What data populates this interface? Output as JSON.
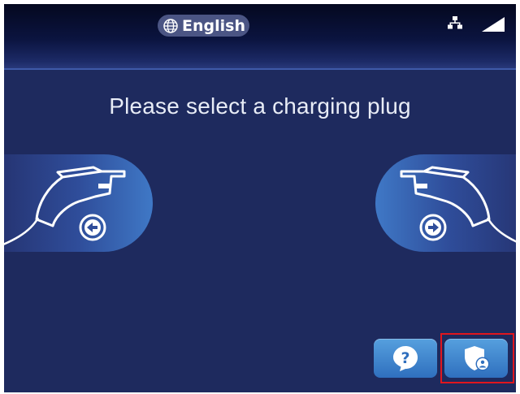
{
  "header": {
    "language_label": "English",
    "language_icon": "globe-icon",
    "network_icon": "network-icon",
    "signal_icon": "signal-strength-icon"
  },
  "main": {
    "title": "Please select a charging plug",
    "plugs": [
      {
        "side": "left",
        "icon": "charging-plug-icon",
        "arrow_icon": "arrow-left-circle-icon"
      },
      {
        "side": "right",
        "icon": "charging-plug-icon",
        "arrow_icon": "arrow-right-circle-icon"
      }
    ]
  },
  "footer": {
    "help_icon": "question-bubble-icon",
    "admin_icon": "shield-user-icon"
  },
  "colors": {
    "background": "#1e2a5e",
    "accent_button": "#3f85cf",
    "highlight": "#e0161e"
  }
}
